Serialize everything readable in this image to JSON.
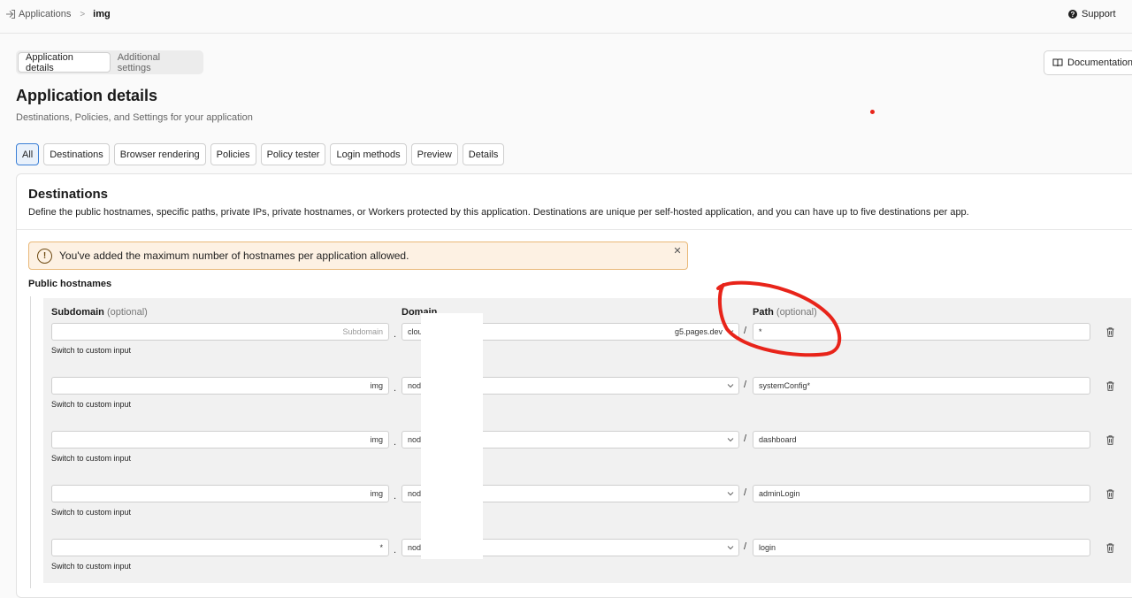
{
  "breadcrumb": {
    "parent": "Applications",
    "current": "img"
  },
  "header": {
    "support_label": "Support"
  },
  "top_tabs": [
    {
      "label": "Application details",
      "active": true
    },
    {
      "label": "Additional settings",
      "active": false
    }
  ],
  "documentation_label": "Documentation",
  "page": {
    "title": "Application details",
    "subtitle": "Destinations, Policies, and Settings for your application"
  },
  "filter_chips": [
    {
      "label": "All",
      "active": true
    },
    {
      "label": "Destinations",
      "active": false
    },
    {
      "label": "Browser rendering",
      "active": false
    },
    {
      "label": "Policies",
      "active": false
    },
    {
      "label": "Policy tester",
      "active": false
    },
    {
      "label": "Login methods",
      "active": false
    },
    {
      "label": "Preview",
      "active": false
    },
    {
      "label": "Details",
      "active": false
    }
  ],
  "destinations": {
    "title": "Destinations",
    "description": "Define the public hostnames, specific paths, private IPs, private hostnames, or Workers protected by this application. Destinations are unique per self-hosted application, and you can have up to five destinations per app.",
    "alert": "You've added the maximum number of hostnames per application allowed.",
    "section_label": "Public hostnames",
    "columns": {
      "subdomain": "Subdomain",
      "subdomain_optional": "(optional)",
      "domain": "Domain",
      "path": "Path",
      "path_optional": "(optional)"
    },
    "separators": {
      "dot": ".",
      "slash": "/"
    },
    "switch_label": "Switch to custom input",
    "rows": [
      {
        "subdomain": "Subdomain",
        "subdomain_is_placeholder": true,
        "domain": "clou",
        "domain_tail": "g5.pages.dev",
        "path": "*"
      },
      {
        "subdomain": "img",
        "subdomain_is_placeholder": false,
        "domain": "node",
        "domain_tail": "",
        "path": "systemConfig*"
      },
      {
        "subdomain": "img",
        "subdomain_is_placeholder": false,
        "domain": "node",
        "domain_tail": "",
        "path": "dashboard"
      },
      {
        "subdomain": "img",
        "subdomain_is_placeholder": false,
        "domain": "node",
        "domain_tail": "",
        "path": "adminLogin"
      },
      {
        "subdomain": "*",
        "subdomain_is_placeholder": false,
        "domain": "node",
        "domain_tail": "",
        "path": "login"
      }
    ]
  },
  "colors": {
    "accent": "#3b7fd6",
    "alert_bg": "#fdf1e3",
    "alert_border": "#e9b878",
    "annotation_red": "#e8241a"
  },
  "icons": {
    "breadcrumb": "sign-in-icon",
    "support": "question-circle-icon",
    "documentation": "book-icon",
    "alert": "exclamation-circle-icon",
    "alert_close": "close-icon",
    "select": "chevron-down-icon",
    "row_delete": "trash-icon"
  }
}
